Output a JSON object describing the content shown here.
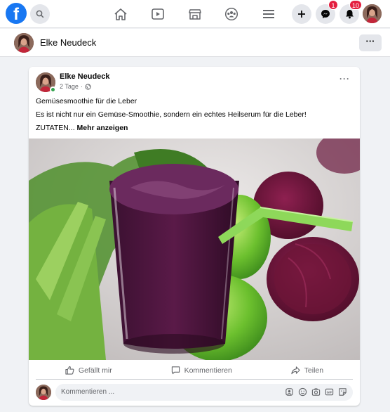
{
  "nav": {
    "logo": "f",
    "badges": {
      "messenger": "1",
      "notifications": "10"
    }
  },
  "profile": {
    "name": "Elke Neudeck"
  },
  "post": {
    "author": "Elke Neudeck",
    "time": "2 Tage",
    "separator": "·",
    "line1": "Gemüsesmoothie für die Leber",
    "line2": "Es ist nicht nur ein Gemüse-Smoothie, sondern ein echtes Heilserum für die Leber!",
    "line3_prefix": "ZUTATEN...",
    "see_more": "Mehr anzeigen",
    "more": "···"
  },
  "actions": {
    "like": "Gefällt mir",
    "comment": "Kommentieren",
    "share": "Teilen"
  },
  "comment_input": {
    "placeholder": "Kommentieren ..."
  },
  "subhead_more": "···"
}
